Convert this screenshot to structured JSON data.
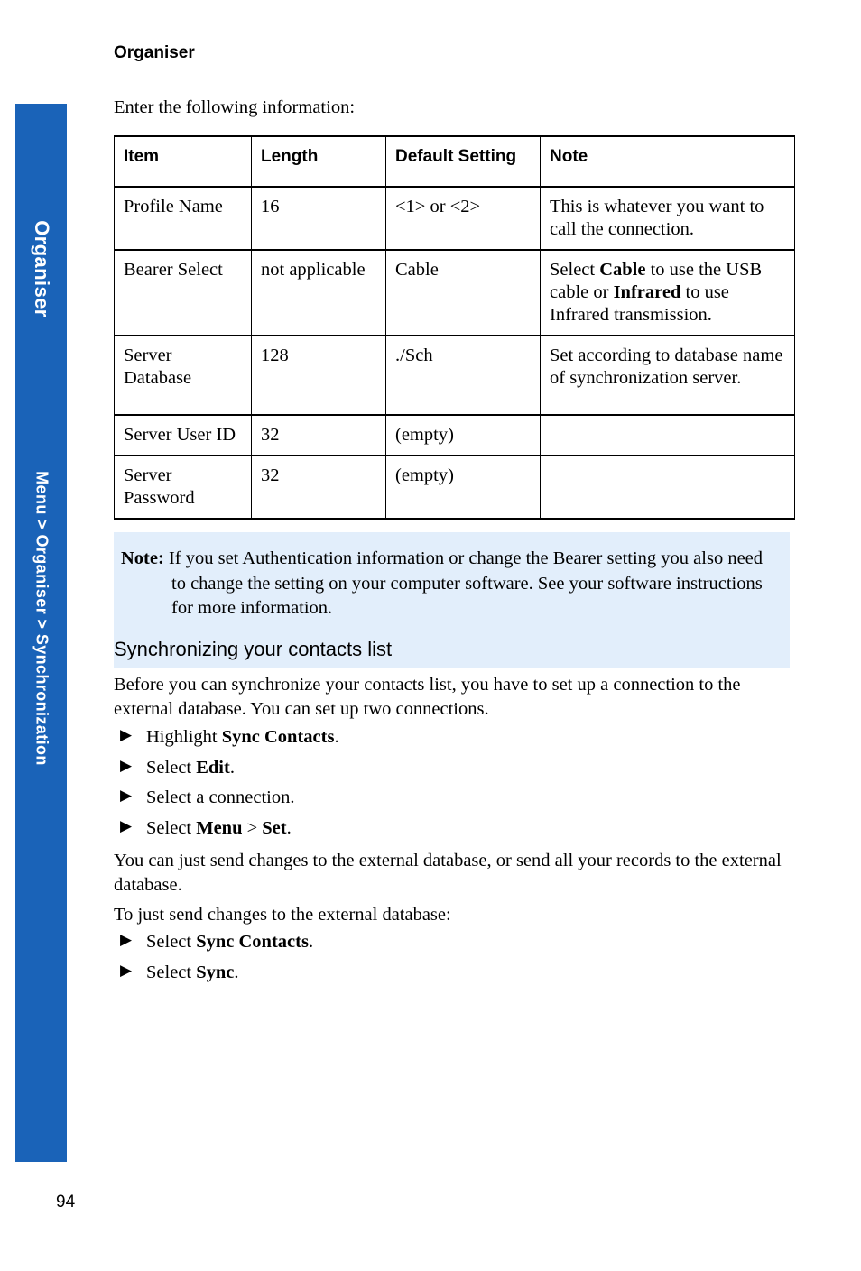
{
  "sidebar": {
    "chapter_label": "Organiser",
    "breadcrumb_label": "Menu > Organiser > Synchronization",
    "color": "#1a63b8"
  },
  "page": {
    "running_head": "Organiser",
    "number": "94"
  },
  "intro": {
    "text": "Enter the following information:"
  },
  "table": {
    "headers": [
      "Item",
      "Length",
      "Default Setting",
      "Note"
    ],
    "rows": [
      {
        "item": "Profile Name",
        "length": "16",
        "default": "<1> or <2>",
        "note_plain": "This is whatever you want to call the connection."
      },
      {
        "item": "Bearer Select",
        "length": "not applicable",
        "default": "Cable",
        "note_parts": {
          "a": "Select ",
          "b_bold": "Cable",
          "c": " to use the USB cable or ",
          "d_bold": "Infrared",
          "e": " to use Infrared transmission."
        }
      },
      {
        "item": "Server Database",
        "length": "128",
        "default": "./Sch",
        "note_plain": "Set according to database name of synchronization server."
      },
      {
        "item": "Server User ID",
        "length": "32",
        "default": "(empty)",
        "note_plain": ""
      },
      {
        "item": "Server Password",
        "length": "32",
        "default": "(empty)",
        "note_plain": ""
      }
    ]
  },
  "note_box": {
    "label": "Note:",
    "text": " If you set Authentication information or change the Bearer setting you also need to change the setting on your computer software. See your software instructions for more information.",
    "background_color": "#e2eefb"
  },
  "section": {
    "heading": "Synchronizing your contacts list",
    "para_before": "Before you can synchronize your contacts list, you have to set up a connection to the external database. You can set up two connections.",
    "setup_steps": [
      {
        "lead": "Highlight ",
        "bold": "Sync Contacts",
        "tail": "."
      },
      {
        "lead": "Select ",
        "bold": "Edit",
        "tail": "."
      },
      {
        "lead": "Select a connection.",
        "bold": "",
        "tail": ""
      },
      {
        "lead": "Select ",
        "bold": "Menu",
        "mid": " > ",
        "bold2": "Set",
        "tail": "."
      }
    ],
    "para_youcan": "You can just send changes to the external database, or send all your records to the external database.",
    "para_tojust": "To just send changes to the external database:",
    "send_steps": [
      {
        "lead": "Select ",
        "bold": "Sync Contacts",
        "tail": "."
      },
      {
        "lead": "Select ",
        "bold": "Sync",
        "tail": "."
      }
    ],
    "bullet_glyph": "▶"
  }
}
